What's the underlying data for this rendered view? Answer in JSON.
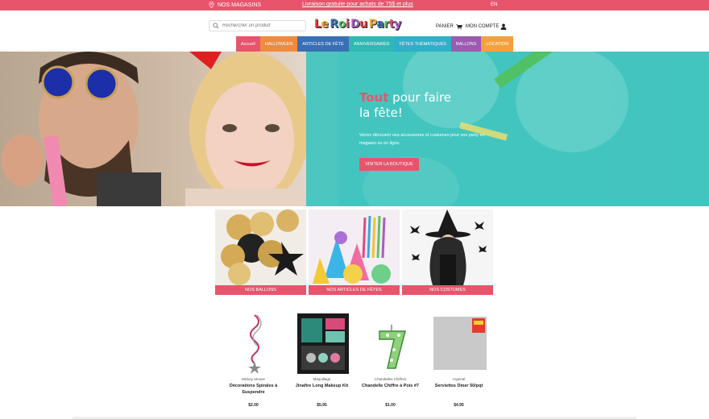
{
  "topbar": {
    "stores_label": "NOS MAGASINS",
    "promo_text": "Livraison gratuite pour achats de 75$ et plus",
    "lang": "EN",
    "color": "#e8546c"
  },
  "header": {
    "search_placeholder": "Rechercher un produit",
    "logo_text": "Le Roi Du Party",
    "cart_label": "PANIER",
    "account_label": "MON COMPTE"
  },
  "nav": {
    "items": [
      {
        "label": "Accueil",
        "color": "#e8546c"
      },
      {
        "label": "HALLOWEEN",
        "color": "#f08a3e"
      },
      {
        "label": "ARTICLES DE FÊTE",
        "color": "#3a6fb5"
      },
      {
        "label": "ANNIVERSAIRES",
        "color": "#2fb8b4"
      },
      {
        "label": "FÊTES THÉMATIQUES",
        "color": "#2fb0c7"
      },
      {
        "label": "BALLONS",
        "color": "#9a5bb0"
      },
      {
        "label": "LOCATION",
        "color": "#f4a13d"
      }
    ]
  },
  "hero": {
    "headline_accent": "Tout",
    "headline_rest": " pour faire",
    "headline_line2": "la fête!",
    "subtext": "Venez découvrir nos accessoires et costumes pour vos party en magasin ou en ligne.",
    "button_label": "VISITER LA BOUTIQUE"
  },
  "categories": [
    {
      "label": "NOS BALLONS"
    },
    {
      "label": "NOS ARTICLES DE FÊTES"
    },
    {
      "label": "NOS COSTUMES"
    }
  ],
  "products": [
    {
      "brand": "Mickey Mouse",
      "name": "Décorations Spirales à Suspendre",
      "price": "$2.00"
    },
    {
      "brand": "Maquillage",
      "name": "Jinafire Long Makeup Kit",
      "price": "$5.95"
    },
    {
      "brand": "Chandelles Chiffres",
      "name": "Chandelle Chiffre à Pois #7",
      "price": "$1.00"
    },
    {
      "brand": "Argenté",
      "name": "Serviettes Diner 50/pqt",
      "price": "$4.95"
    }
  ]
}
